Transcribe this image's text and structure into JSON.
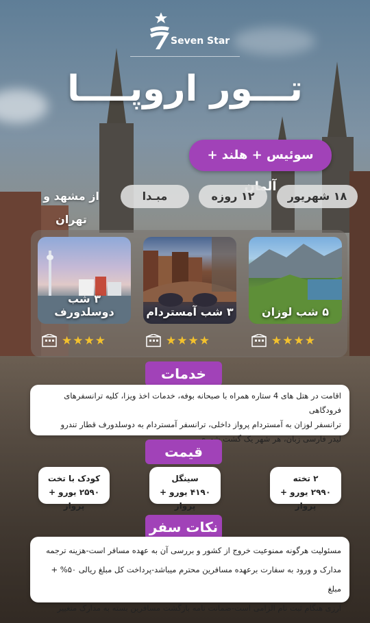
{
  "brand": {
    "name": "Seven Star",
    "logo_icon": "seven-star-logo-icon"
  },
  "title": "تـــور اروپــــا",
  "countries": "سوئیس + هلند + آلمان",
  "trip_info": {
    "date": "۱۸ شهریور",
    "duration": "۱۲ روزه",
    "origin_label": "مبـدا",
    "origin_cities": "از مشهد و تهران"
  },
  "cities": [
    {
      "label": "۵ شب لوزان",
      "stars": "★★★★",
      "rating": 4,
      "icon": "hotel-icon"
    },
    {
      "label": "۳ شب آمستردام",
      "stars": "★★★★",
      "rating": 4,
      "icon": "hotel-icon"
    },
    {
      "label": "۳ شب دوسلدورف",
      "stars": "★★★★",
      "rating": 4,
      "icon": "hotel-icon"
    }
  ],
  "services": {
    "heading": "خدمات",
    "lines": [
      "اقامت در هتل های 4 ستاره همراه با صبحانه بوفه، خدمات اخذ ویزا، کلیه ترانسفرهای فرودگاهی",
      "ترانسفر لوزان به آمستردام پرواز داخلی، ترانسفر آمستردام به دوسلدورف قطار تندرو",
      "لیدر فارسی زبان، هر شهر یک گشت شهری"
    ]
  },
  "price": {
    "heading": "قیمت",
    "items": [
      {
        "title": "۲ تخته",
        "value": "۲۹۹۰ یورو + پرواز"
      },
      {
        "title": "سینگل",
        "value": "۴۱۹۰ یورو + پرواز"
      },
      {
        "title": "کودک با تخت",
        "value": "۲۵۹۰ یورو + پرواز"
      }
    ]
  },
  "notes": {
    "heading": "نکات سفر",
    "lines": [
      "مسئولیت هرگونه ممنوعیت خروج از کشور و بررسی آن به عهده مسافر است-هزینه ترجمه",
      "مدارک و ورود به سفارت برعهده مسافرین محترم میباشد-پرداخت کل مبلغ ریالی ۵۰% + مبلغ",
      "ارزی هنگام ثبت نام الزامی است-ضمانت نامه بازگشت مسافرین بسته به مدارک متغییر میباشد"
    ]
  },
  "colors": {
    "accent": "#a142b8",
    "star": "#f3c12d"
  }
}
